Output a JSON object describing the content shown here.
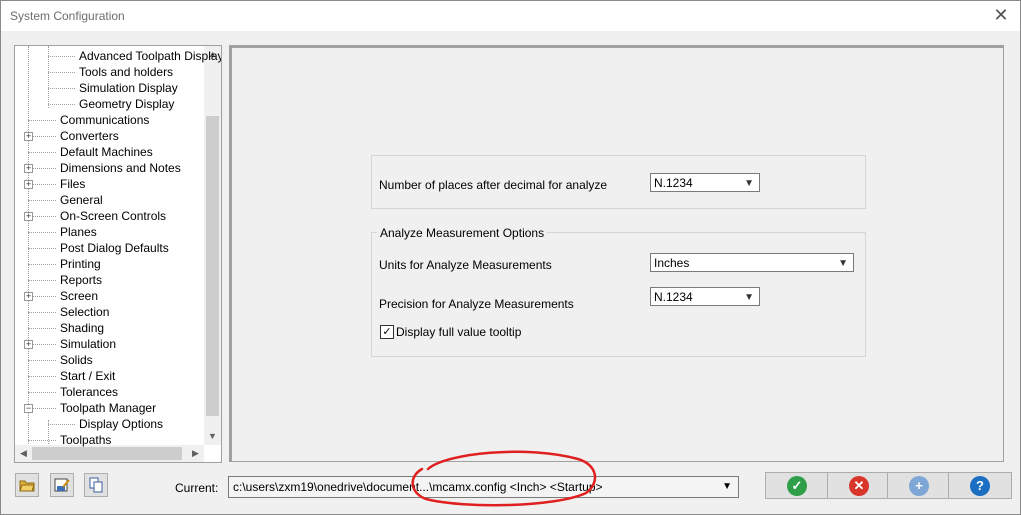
{
  "window": {
    "title": "System Configuration",
    "close_symbol": "✕"
  },
  "tree": {
    "items": [
      {
        "label": "Advanced Toolpath Display",
        "indent": 2,
        "expander": false
      },
      {
        "label": "Tools and holders",
        "indent": 2,
        "expander": false
      },
      {
        "label": "Simulation Display",
        "indent": 2,
        "expander": false
      },
      {
        "label": "Geometry Display",
        "indent": 2,
        "expander": false
      },
      {
        "label": "Communications",
        "indent": 1,
        "expander": false
      },
      {
        "label": "Converters",
        "indent": 1,
        "expander": true
      },
      {
        "label": "Default Machines",
        "indent": 1,
        "expander": false
      },
      {
        "label": "Dimensions and Notes",
        "indent": 1,
        "expander": true
      },
      {
        "label": "Files",
        "indent": 1,
        "expander": true
      },
      {
        "label": "General",
        "indent": 1,
        "expander": false
      },
      {
        "label": "On-Screen Controls",
        "indent": 1,
        "expander": true
      },
      {
        "label": "Planes",
        "indent": 1,
        "expander": false
      },
      {
        "label": "Post Dialog Defaults",
        "indent": 1,
        "expander": false
      },
      {
        "label": "Printing",
        "indent": 1,
        "expander": false
      },
      {
        "label": "Reports",
        "indent": 1,
        "expander": false
      },
      {
        "label": "Screen",
        "indent": 1,
        "expander": true
      },
      {
        "label": "Selection",
        "indent": 1,
        "expander": false
      },
      {
        "label": "Shading",
        "indent": 1,
        "expander": false
      },
      {
        "label": "Simulation",
        "indent": 1,
        "expander": true
      },
      {
        "label": "Solids",
        "indent": 1,
        "expander": false
      },
      {
        "label": "Start / Exit",
        "indent": 1,
        "expander": false
      },
      {
        "label": "Tolerances",
        "indent": 1,
        "expander": false
      },
      {
        "label": "Toolpath Manager",
        "indent": 1,
        "expander": "open"
      },
      {
        "label": "Display Options",
        "indent": 2,
        "expander": false
      },
      {
        "label": "Toolpaths",
        "indent": 1,
        "expander": false
      }
    ]
  },
  "analyze": {
    "decimal_label": "Number of places after decimal for analyze",
    "decimal_value": "N.1234",
    "group_title": "Analyze Measurement Options",
    "units_label": "Units for Analyze Measurements",
    "units_value": "Inches",
    "precision_label": "Precision for Analyze Measurements",
    "precision_value": "N.1234",
    "tooltip_label": "Display full value tooltip",
    "tooltip_checked": true
  },
  "footer": {
    "current_label": "Current:",
    "path_value": "c:\\users\\zxm19\\onedrive\\document...\\mcamx.config <Inch> <Startup>"
  },
  "colors": {
    "ok": "#2f9e48",
    "cancel": "#d9362b",
    "add": "#7fa7d6",
    "help": "#1b6ec2",
    "annotation": "#e02020"
  },
  "icons": [
    "open-folder-icon",
    "save-edit-icon",
    "copy-icon",
    "ok-check-icon",
    "cancel-x-icon",
    "add-plus-icon",
    "help-question-icon"
  ]
}
